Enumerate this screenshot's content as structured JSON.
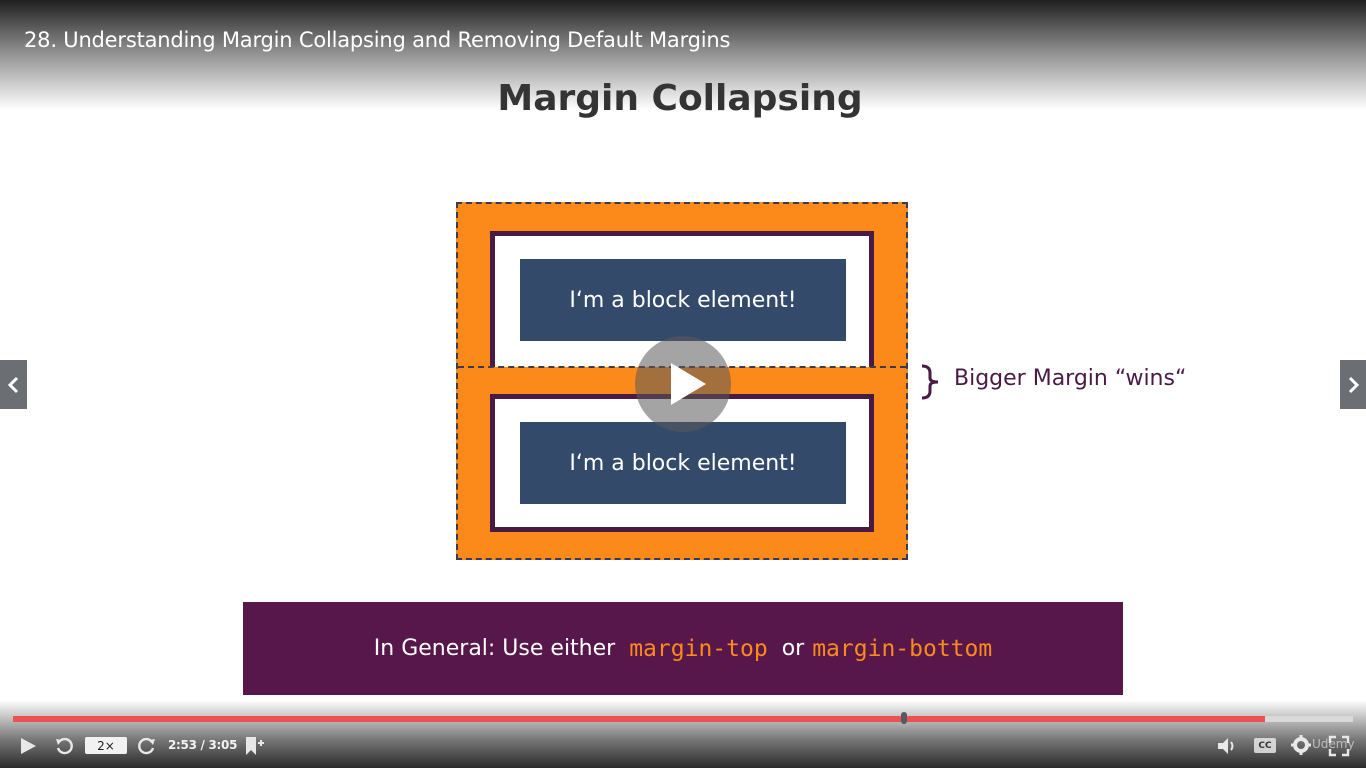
{
  "video": {
    "title": "28. Understanding Margin Collapsing and Removing Default Margins"
  },
  "slide": {
    "title": "Margin Collapsing",
    "block_label_top": "I‘m a block element!",
    "block_label_bottom": "I‘m a block element!",
    "brace_label": "Bigger Margin “wins“",
    "general_prefix": "In General: Use either",
    "general_code_1": "margin-top",
    "general_or": "or",
    "general_code_2": "margin-bottom"
  },
  "player": {
    "speed": "2×",
    "time": "2:53 / 3:05",
    "progress": 0.665,
    "buffered": 0.934,
    "cc_label": "CC",
    "watermark": "Udemy"
  },
  "icons": {
    "play": "play-icon",
    "rewind": "rewind-icon",
    "forward": "forward-icon",
    "bookmark": "bookmark-add-icon",
    "volume": "volume-icon",
    "settings": "gear-icon",
    "fullscreen": "fullscreen-icon",
    "prev": "chevron-left-icon",
    "next": "chevron-right-icon"
  },
  "colors": {
    "orange": "#fb8a1b",
    "purple": "#58174a",
    "navy": "#344a6a",
    "progress_red": "#ec5252"
  }
}
